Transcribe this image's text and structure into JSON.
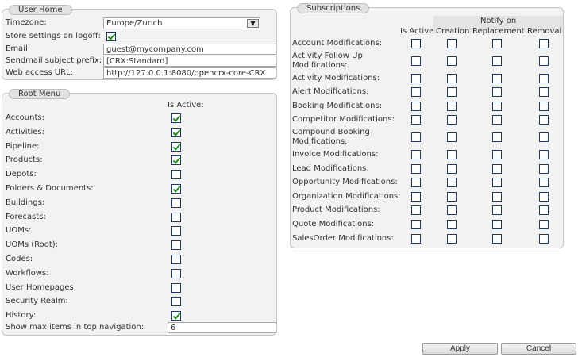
{
  "user_home": {
    "title": "User Home",
    "timezone_label": "Timezone:",
    "timezone_value": "Europe/Zurich",
    "store_settings_label": "Store settings on logoff:",
    "store_settings_checked": true,
    "email_label": "Email:",
    "email_value": "guest@mycompany.com",
    "sendmail_label": "Sendmail subject prefix:",
    "sendmail_value": "[CRX:Standard]",
    "web_access_label": "Web access URL:",
    "web_access_value": "http://127.0.0.1:8080/opencrx-core-CRX"
  },
  "root_menu": {
    "title": "Root Menu",
    "is_active_header": "Is Active:",
    "items": [
      {
        "label": "Accounts:",
        "checked": true
      },
      {
        "label": "Activities:",
        "checked": true
      },
      {
        "label": "Pipeline:",
        "checked": true
      },
      {
        "label": "Products:",
        "checked": true
      },
      {
        "label": "Depots:",
        "checked": false
      },
      {
        "label": "Folders & Documents:",
        "checked": true
      },
      {
        "label": "Buildings:",
        "checked": false
      },
      {
        "label": "Forecasts:",
        "checked": false
      },
      {
        "label": "UOMs:",
        "checked": false
      },
      {
        "label": "UOMs (Root):",
        "checked": false
      },
      {
        "label": "Codes:",
        "checked": false
      },
      {
        "label": "Workflows:",
        "checked": false
      },
      {
        "label": "User Homepages:",
        "checked": false
      },
      {
        "label": "Security Realm:",
        "checked": false
      },
      {
        "label": "History:",
        "checked": true
      }
    ],
    "max_items_label": "Show max items in top navigation:",
    "max_items_value": "6"
  },
  "subscriptions": {
    "title": "Subscriptions",
    "notify_on_header": "Notify on",
    "col_is_active": "Is Active",
    "col_creation": "Creation",
    "col_replacement": "Replacement",
    "col_removal": "Removal",
    "rows": [
      {
        "label": "Account Modifications:"
      },
      {
        "label": "Activity Follow Up Modifications:",
        "two_line": true
      },
      {
        "label": "Activity Modifications:"
      },
      {
        "label": "Alert Modifications:"
      },
      {
        "label": "Booking Modifications:"
      },
      {
        "label": "Competitor Modifications:"
      },
      {
        "label": "Compound Booking Modifications:",
        "two_line": true
      },
      {
        "label": "Invoice Modifications:"
      },
      {
        "label": "Lead Modifications:"
      },
      {
        "label": "Opportunity Modifications:"
      },
      {
        "label": "Organization Modifications:"
      },
      {
        "label": "Product Modifications:"
      },
      {
        "label": "Quote Modifications:"
      },
      {
        "label": "SalesOrder Modifications:"
      }
    ]
  },
  "actions": {
    "apply_label": "Apply",
    "cancel_label": "Cancel"
  }
}
